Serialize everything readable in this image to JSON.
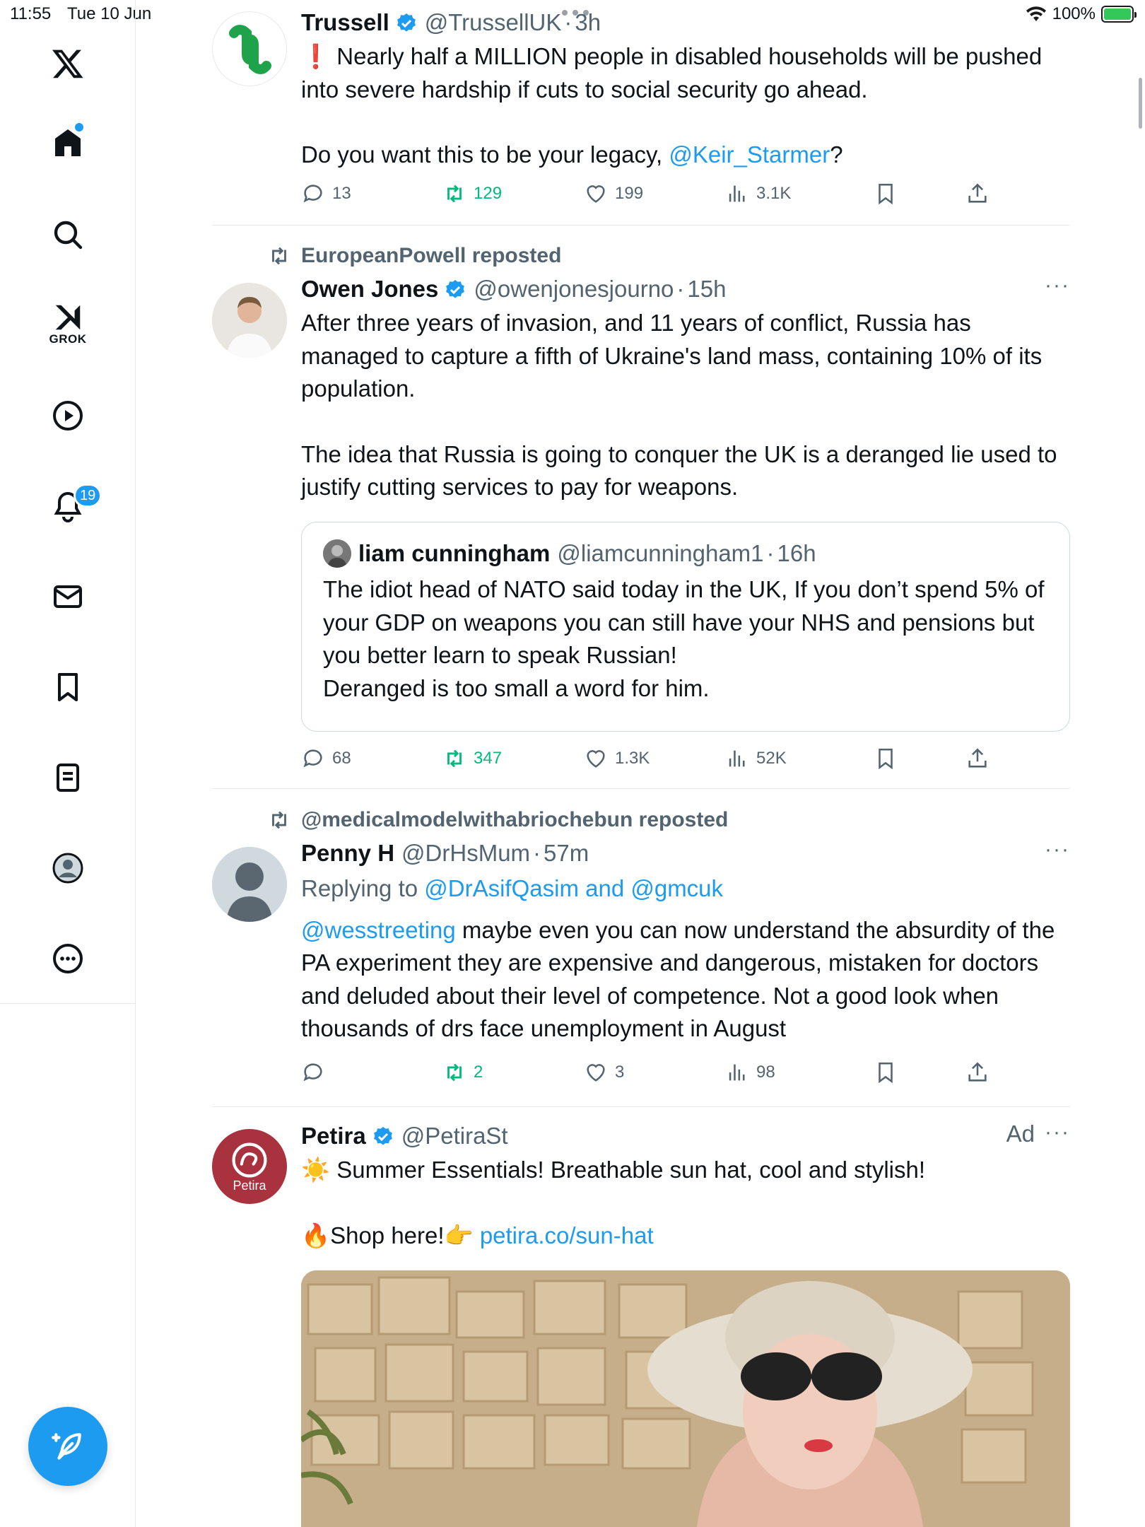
{
  "status": {
    "time": "11:55",
    "date": "Tue 10 Jun",
    "battery": "100%",
    "battery_level": 1.0
  },
  "sidebar": {
    "grok_label": "GROK",
    "notification_count": "19",
    "items": [
      "x-logo",
      "home",
      "search",
      "grok",
      "videos",
      "notifications",
      "messages",
      "bookmarks",
      "lists",
      "profile",
      "more"
    ]
  },
  "tweets": [
    {
      "name": "Trussell",
      "handle": "@TrussellUK",
      "time": "3h",
      "text_1": "❗ Nearly half a MILLION people in disabled households will be pushed into severe hardship if cuts to social security go ahead.",
      "text_2_pre": "Do you want this to be your legacy, ",
      "text_2_link": "@Keir_Starmer",
      "text_2_post": "?",
      "replies": "13",
      "reposts": "129",
      "likes": "199",
      "views": "3.1K"
    },
    {
      "reposted_by": "EuropeanPowell reposted",
      "name": "Owen Jones",
      "handle": "@owenjonesjourno",
      "time": "15h",
      "text_1": "After three years of invasion, and 11 years of conflict, Russia has managed to capture a fifth of Ukraine's land mass, containing 10% of its population.",
      "text_2": "The idea that Russia is going to conquer the UK is a deranged lie used to justify cutting services to pay for weapons.",
      "quote": {
        "name": "liam cunningham",
        "handle": "@liamcunningham1",
        "time": "16h",
        "text_1": "The idiot head of NATO said today in the UK,  If you don’t spend 5% of your GDP on weapons you can still have your NHS and pensions but you better learn to speak Russian!",
        "text_2": "Deranged is too small a word for him."
      },
      "replies": "68",
      "reposts": "347",
      "likes": "1.3K",
      "views": "52K"
    },
    {
      "reposted_by": "@medicalmodelwithabriochebun reposted",
      "name": "Penny H",
      "handle": "@DrHsMum",
      "time": "57m",
      "replying_prefix": "Replying to ",
      "replying_to": "@DrAsifQasim and @gmcuk",
      "text_link": "@wesstreeting",
      "text": " maybe even you can now understand the absurdity of the PA experiment they are expensive and dangerous, mistaken for doctors and deluded about their level of competence. Not a good look when thousands of drs face unemployment in August",
      "replies": "",
      "reposts": "2",
      "likes": "3",
      "views": "98"
    },
    {
      "name": "Petira",
      "handle": "@PetiraSt",
      "ad_label": "Ad",
      "avatar_text": "Petira",
      "text_1": "☀️ Summer Essentials! Breathable sun hat, cool and stylish!",
      "text_2_pre": "🔥Shop here!👉 ",
      "text_2_link": "petira.co/sun-hat"
    }
  ],
  "colors": {
    "accent": "#1d9bf0",
    "repost_green": "#00ba7c",
    "muted": "#536471",
    "trussell_green": "#1fa34a",
    "petira_red": "#a8323e"
  }
}
